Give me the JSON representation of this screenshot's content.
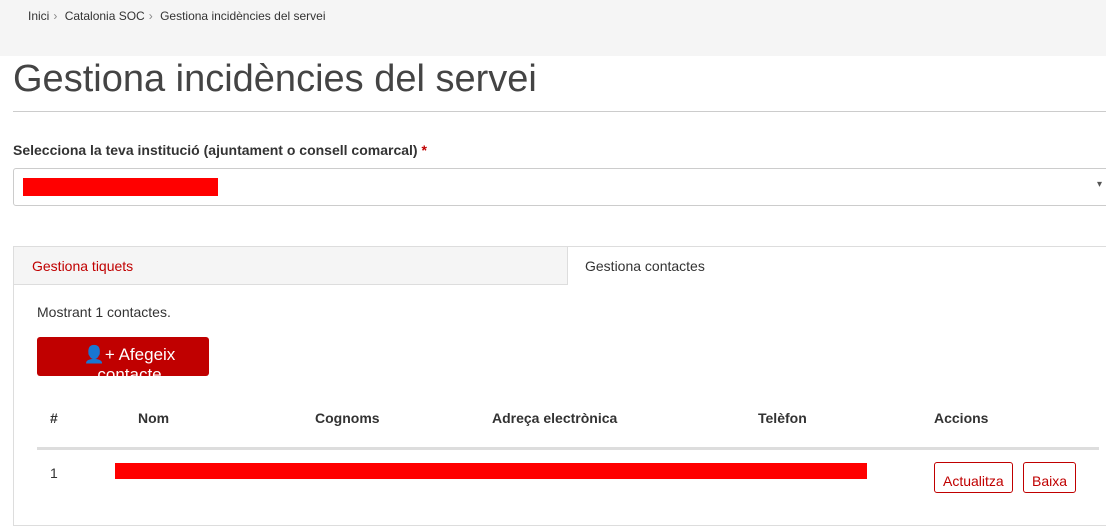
{
  "breadcrumb": [
    "Inici",
    "Catalonia SOC",
    "Gestiona incidències del servei"
  ],
  "page_title": "Gestiona incidències del servei",
  "institution": {
    "label": "Selecciona la teva institució (ajuntament o consell comarcal)",
    "required_mark": "*"
  },
  "tabs": [
    {
      "label": "Gestiona tiquets",
      "active": false
    },
    {
      "label": "Gestiona contactes",
      "active": true
    }
  ],
  "contacts": {
    "count_text": "Mostrant 1 contactes.",
    "add_label": "Afegeix contacte",
    "columns": [
      "#",
      "Nom",
      "Cognoms",
      "Adreça electrònica",
      "Telèfon",
      "Accions"
    ],
    "rows": [
      {
        "index": "1",
        "update_label": "Actualitza",
        "delete_label": "Baixa"
      }
    ]
  },
  "colors": {
    "accent": "#c00000",
    "redaction": "#ff0000"
  }
}
